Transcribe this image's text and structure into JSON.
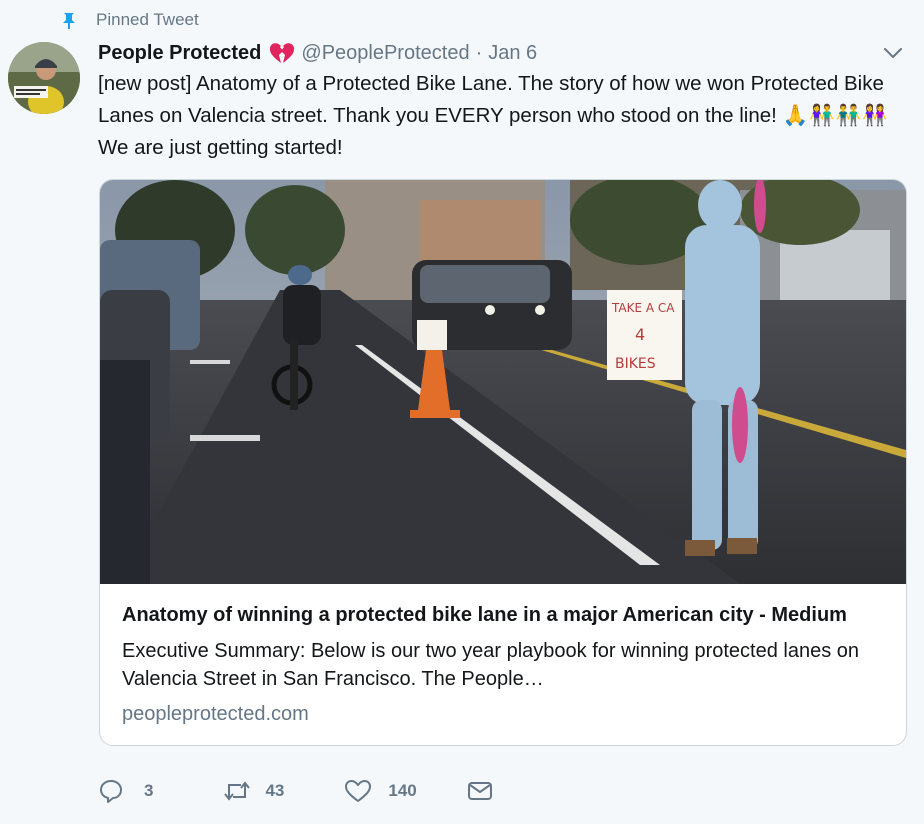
{
  "pinned": {
    "label": "Pinned Tweet"
  },
  "tweet": {
    "display_name": "People Protected",
    "handle": "@PeopleProtected",
    "separator": "·",
    "date": "Jan 6",
    "text_main": "[new post] Anatomy of a Protected Bike Lane. The story of how we won Protected Bike Lanes on Valencia street. Thank you EVERY person who stood on the line!",
    "emojis": "🙏👫👬👭",
    "text_tail": "We are just getting started!"
  },
  "card": {
    "sign_text": "TAKE A CAR 4 BIKES",
    "title": "Anatomy of winning a protected bike lane in a major American city - Medium",
    "description": "Executive Summary: Below is our two year playbook for winning protected lanes on Valencia Street in San Francisco. The People…",
    "domain": "peopleprotected.com"
  },
  "actions": {
    "replies": "3",
    "retweets": "43",
    "likes": "140"
  },
  "icons": {
    "pin": "pin-icon",
    "heart": "broken-heart-icon",
    "chevron": "chevron-down-icon",
    "reply": "reply-icon",
    "retweet": "retweet-icon",
    "like": "like-icon",
    "dm": "direct-message-icon"
  },
  "colors": {
    "accent": "#1da1f2",
    "muted": "#657786",
    "broken_heart": "#e0245e"
  }
}
